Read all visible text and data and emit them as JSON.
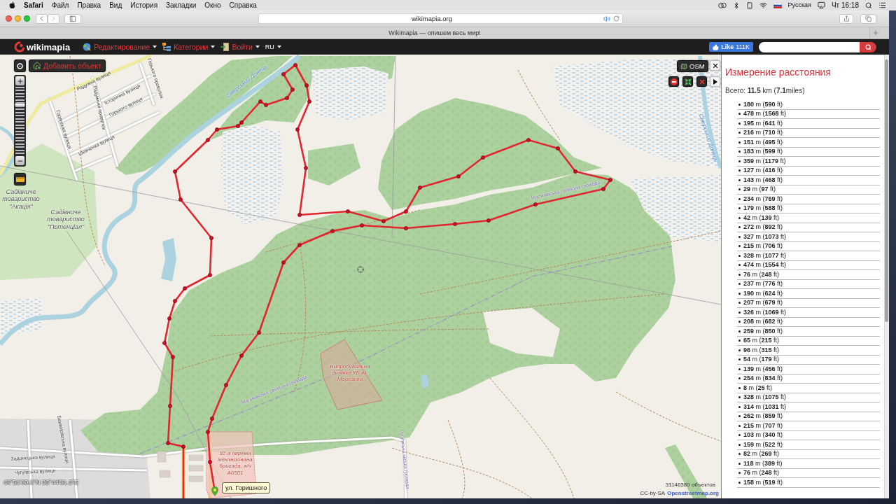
{
  "menu_bar": {
    "app": "Safari",
    "items": [
      "Файл",
      "Правка",
      "Вид",
      "История",
      "Закладки",
      "Окно",
      "Справка"
    ],
    "input_source": "Русская",
    "clock": "Чт 16:18"
  },
  "browser": {
    "url": "wikimapia.org",
    "tab_title": "Wikimapia — опишем весь мир!"
  },
  "site_header": {
    "logo": "wikimapia",
    "nav": [
      {
        "kind": "menu",
        "label": "Редактирование"
      },
      {
        "kind": "menu",
        "label": "Категории"
      },
      {
        "kind": "menu",
        "label": "Войти"
      },
      {
        "kind": "lang",
        "label": "RU"
      }
    ],
    "like_button": {
      "label": "Like",
      "count": "111K"
    }
  },
  "map": {
    "add_object_button": "Добавить объект",
    "zoom": {
      "level": 0.75
    },
    "layer_button": "OSM",
    "labels": [
      {
        "kind": "street",
        "text": "Радужна вулиця"
      },
      {
        "kind": "street",
        "text": "Історична вулиця"
      },
      {
        "kind": "street",
        "text": "Горького вулиця"
      },
      {
        "kind": "street",
        "text": "Шевченка вулиця"
      },
      {
        "kind": "street",
        "text": "Горянська вулиця"
      },
      {
        "kind": "street",
        "text": "Радужний провулок"
      },
      {
        "kind": "street",
        "text": "Горького провулок"
      },
      {
        "kind": "river",
        "text": "Сіверський Донець"
      },
      {
        "kind": "river",
        "text": "Сіверський Донець"
      },
      {
        "kind": "area",
        "text": "Садівниче товариство \"Акація\""
      },
      {
        "kind": "area",
        "text": "Садівниче товариство \"Потенціал\""
      },
      {
        "kind": "boundary",
        "text": "Малинівська селищна громада"
      },
      {
        "kind": "site",
        "text": "Випробувальна ділянка КБ ім. Морозова"
      },
      {
        "kind": "boundary",
        "text": "Малинівська селищна громада"
      },
      {
        "kind": "site",
        "text": "92-а окрема механізована бригада, в/ч А0501"
      },
      {
        "kind": "boundary",
        "text": "Чугуївська міська громада"
      },
      {
        "kind": "street",
        "text": "Задонецька вулиця"
      },
      {
        "kind": "street",
        "text": "Чугуївська вулиця"
      },
      {
        "kind": "street",
        "text": "Башкирівська вулиця"
      }
    ],
    "coordinates": "49°51'30.2\"N 36°44'31.3\"E",
    "tooltip": "ул. Горишного",
    "objects_count": "31146380 объектов",
    "attribution": {
      "text": "CC-by-SA",
      "link": "Openstreetmap.org"
    }
  },
  "measure_panel": {
    "title": "Измерение расстояния",
    "total": "Всего: **11.5** km (**7.1**miles)",
    "segments": [
      "**180** m (**590** ft)",
      "**478** m (**1568** ft)",
      "**195** m (**641** ft)",
      "**216** m (**710** ft)",
      "**151** m (**495** ft)",
      "**183** m (**599** ft)",
      "**359** m (**1179** ft)",
      "**127** m (**416** ft)",
      "**143** m (**468** ft)",
      "**29** m (**97** ft)",
      "**234** m (**769** ft)",
      "**179** m (**588** ft)",
      "**42** m (**139** ft)",
      "**272** m (**892** ft)",
      "**327** m (**1073** ft)",
      "**215** m (**706** ft)",
      "**328** m (**1077** ft)",
      "**474** m (**1554** ft)",
      "**76** m (**248** ft)",
      "**237** m (**776** ft)",
      "**190** m (**624** ft)",
      "**207** m (**679** ft)",
      "**326** m (**1069** ft)",
      "**208** m (**682** ft)",
      "**259** m (**850** ft)",
      "**65** m (**215** ft)",
      "**96** m (**315** ft)",
      "**54** m (**179** ft)",
      "**139** m (**456** ft)",
      "**254** m (**834** ft)",
      "**8** m (**25** ft)",
      "**328** m (**1075** ft)",
      "**314** m (**1031** ft)",
      "**262** m (**859** ft)",
      "**215** m (**707** ft)",
      "**103** m (**340** ft)",
      "**159** m (**522** ft)",
      "**82** m (**269** ft)",
      "**118** m (**389** ft)",
      "**76** m (**248** ft)",
      "**158** m (**519** ft)"
    ]
  }
}
